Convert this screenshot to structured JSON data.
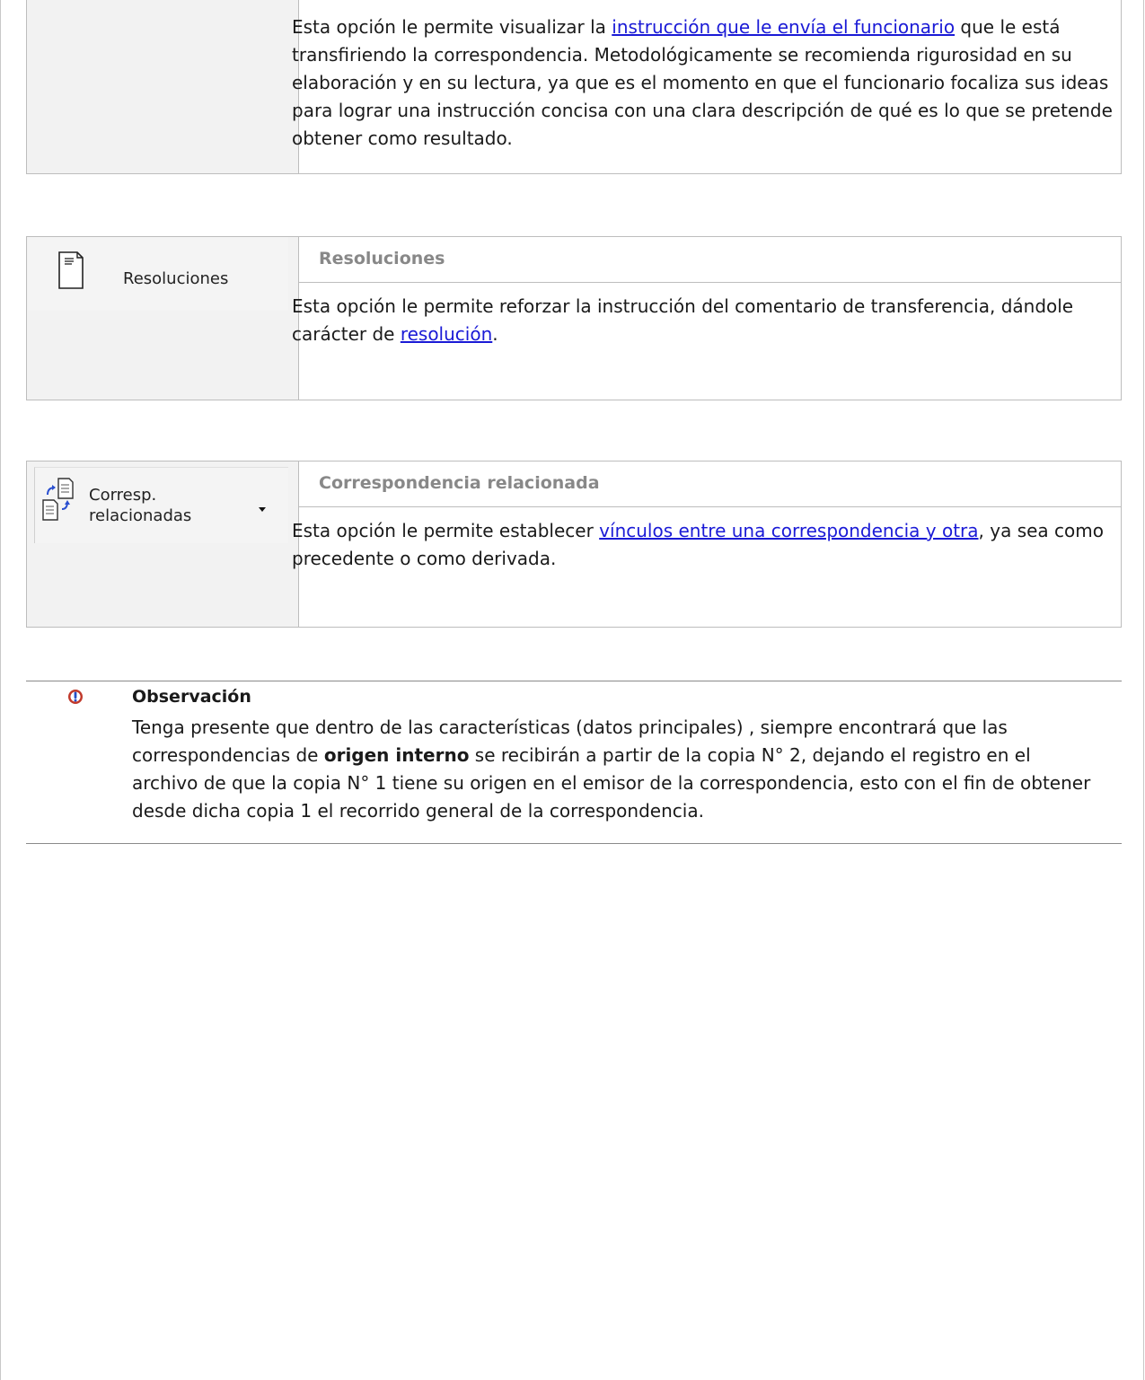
{
  "block1": {
    "desc_pre": "Esta opción le permite visualizar la ",
    "desc_link": "instrucción que le envía el funcionario",
    "desc_post": " que le está transfiriendo la correspondencia. Metodológicamente se recomienda rigurosidad en su elaboración y en su lectura, ya que es el momento en que el funcionario focaliza sus ideas para lograr una instrucción concisa con una clara descripción de qué es lo que se pretende obtener como resultado."
  },
  "block2": {
    "button_label": "Resoluciones",
    "button_icon": "document-icon",
    "title": "Resoluciones",
    "desc_pre": "Esta opción le permite reforzar la instrucción del comentario de transferencia, dándole carácter de ",
    "desc_link": "resolución",
    "desc_post": "."
  },
  "block3": {
    "button_label_line1": "Corresp.",
    "button_label_line2": "relacionadas",
    "button_icon": "related-documents-icon",
    "title": "Correspondencia relacionada",
    "desc_pre": "Esta opción le permite establecer ",
    "desc_link": "vínculos entre una correspondencia y otra",
    "desc_post": ", ya sea como precedente o como derivada."
  },
  "note": {
    "icon": "info-warning-icon",
    "title": "Observación",
    "text_1": "Tenga presente que dentro de las características (datos principales) , siempre encontrará que las correspondencias de ",
    "text_bold": "origen interno",
    "text_2": " se recibirán a partir de la copia N° 2, dejando el registro en el archivo de que la copia N° 1 tiene su origen en el emisor de la correspondencia, esto con el fin de obtener desde dicha copia 1 el recorrido general de la correspondencia."
  }
}
